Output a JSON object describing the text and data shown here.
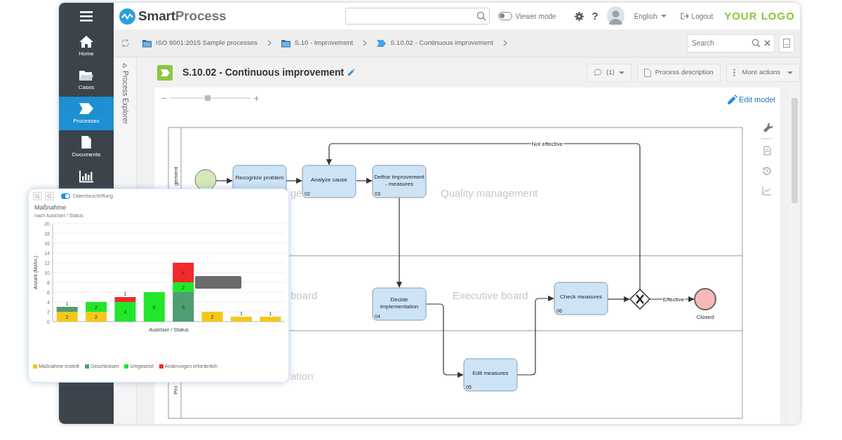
{
  "sidebar": {
    "items": [
      {
        "label": "Home",
        "selected": false
      },
      {
        "label": "Cases",
        "selected": false
      },
      {
        "label": "Processes",
        "selected": true
      },
      {
        "label": "Documents",
        "selected": false
      },
      {
        "selected": false
      }
    ]
  },
  "header": {
    "brand": {
      "part_1": "Smart",
      "part_2": "Process"
    },
    "viewer_mode": {
      "label": "Viewer mode",
      "on": false
    },
    "help": "?",
    "language": "English",
    "logout": "Logout",
    "customer_logo": "YOUR LOGO"
  },
  "breadcrumb": {
    "items": [
      {
        "label": "ISO 9001:2015 Sample processes",
        "kind": "folder"
      },
      {
        "label": "S.10 - Improvement",
        "kind": "folder"
      },
      {
        "label": "S.10.02 - Continuous improvement",
        "kind": "process"
      }
    ],
    "search": {
      "placeholder": "Search"
    }
  },
  "process_explorer": {
    "label": "Process Explorer"
  },
  "title_bar": {
    "title": "S.10.02 - Continuous improvement",
    "comments": "(1)",
    "actions": [
      "Process description",
      "More actions"
    ]
  },
  "canvas": {
    "zoom": {
      "level": 0.47
    },
    "edit_model": "Edit model",
    "lanes": [
      {
        "side_label": "gement",
        "watermarks": [
          "ge",
          "Quality management"
        ]
      },
      {
        "watermarks": [
          "board",
          "Executive board"
        ]
      },
      {
        "side_label": "Pro",
        "watermarks": [
          "ation"
        ]
      }
    ],
    "nodes": [
      {
        "kind": "start"
      },
      {
        "kind": "task",
        "lines": [
          "Recognize problem"
        ]
      },
      {
        "kind": "task",
        "lines": [
          "Analyze cause"
        ],
        "number": "02"
      },
      {
        "kind": "task",
        "lines": [
          "Define improvement",
          "- measures"
        ],
        "number": "03"
      },
      {
        "kind": "task",
        "lines": [
          "Decide",
          "implementation"
        ],
        "number": "04"
      },
      {
        "kind": "task",
        "lines": [
          "Edit measures"
        ],
        "number": "05"
      },
      {
        "kind": "task",
        "lines": [
          "Check measures"
        ],
        "number": "06"
      },
      {
        "kind": "gateway"
      },
      {
        "kind": "end",
        "label": "Closed"
      }
    ],
    "flow_labels": [
      "Not effective",
      "Effective"
    ]
  },
  "chart_panel": {
    "data_labels_toggle": {
      "label": "Datenbeschriftung",
      "on": true
    },
    "title": "Maßnahme",
    "subtitle": "nach Auslöser / Status",
    "chart_data": {
      "type": "bar",
      "stacked": true,
      "grid": true,
      "xlabel": "Auslöser / Status",
      "ylabel": "Anzahl (Maßn.)",
      "ylim": [
        0,
        20
      ],
      "yticks": [
        0,
        2,
        4,
        6,
        8,
        10,
        12,
        14,
        16,
        18,
        20
      ],
      "series": [
        {
          "name": "Maßnahme erstellt",
          "color": "#f5c71a",
          "values": [
            2,
            2,
            0,
            0,
            0,
            2,
            1,
            1
          ],
          "value_labels": [
            "2",
            "2",
            null,
            null,
            null,
            "2",
            "1",
            "1"
          ]
        },
        {
          "name": "Geschlossen",
          "color": "#4e9e72",
          "values": [
            1,
            0,
            0,
            0,
            6,
            0,
            0,
            0
          ],
          "value_labels": [
            "1",
            null,
            null,
            null,
            "6",
            null,
            null,
            null
          ]
        },
        {
          "name": "Umgesetzt",
          "color": "#22e62a",
          "values": [
            0,
            2,
            4,
            6,
            2,
            0,
            0,
            0
          ],
          "value_labels": [
            null,
            "2",
            "4",
            "6",
            "2",
            null,
            null,
            null
          ]
        },
        {
          "name": "Änderungen erforderlich",
          "color": "#f22a2a",
          "values": [
            0,
            0,
            1,
            0,
            4,
            0,
            0,
            0
          ],
          "value_labels": [
            null,
            null,
            "1",
            null,
            "4",
            null,
            null,
            null
          ]
        }
      ]
    }
  }
}
